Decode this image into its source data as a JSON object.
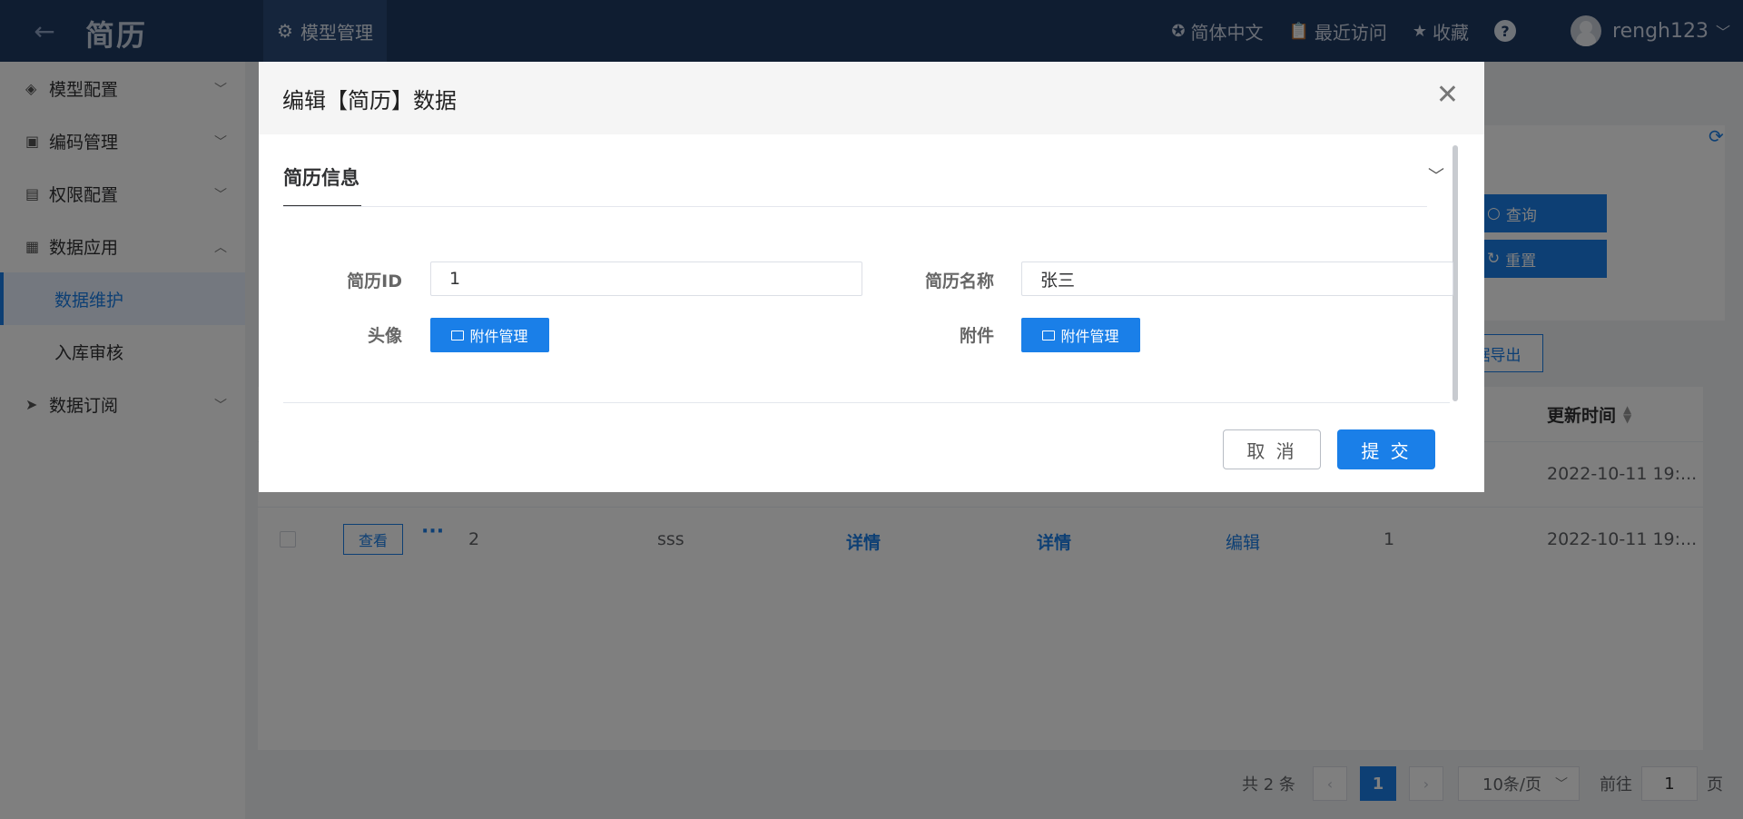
{
  "header": {
    "title": "简历",
    "tab_label": "模型管理",
    "language": "简体中文",
    "recent": "最近访问",
    "favorites": "收藏",
    "help": "?",
    "username": "rengh123"
  },
  "sidebar": {
    "items": [
      {
        "label": "模型配置",
        "icon": "cube-icon"
      },
      {
        "label": "编码管理",
        "icon": "chart-icon"
      },
      {
        "label": "权限配置",
        "icon": "lock-doc-icon"
      },
      {
        "label": "数据应用",
        "icon": "grid-icon"
      }
    ],
    "sub_items": [
      "数据维护",
      "入库审核"
    ],
    "last_item": {
      "label": "数据订阅",
      "icon": "send-icon"
    }
  },
  "background": {
    "query_btn": "查询",
    "reset_btn": "重置",
    "export_btn": "据导出",
    "col_update_time": "更新时间",
    "row1": {
      "time": "2022-10-11 19:..."
    },
    "row2": {
      "view": "查看",
      "dots": "···",
      "id": "2",
      "name": "sss",
      "detail1": "详情",
      "detail2": "详情",
      "edit": "编辑",
      "count": "1",
      "time": "2022-10-11 19:..."
    },
    "pager": {
      "total": "共 2 条",
      "current": "1",
      "page_size": "10条/页",
      "goto": "前往",
      "goto_value": "1",
      "page_suffix": "页"
    }
  },
  "modal": {
    "title": "编辑【简历】数据",
    "section": "简历信息",
    "fields": {
      "id_label": "简历ID",
      "id_value": "1",
      "name_label": "简历名称",
      "name_value": "张三",
      "avatar_label": "头像",
      "attachment_label": "附件",
      "attach_btn": "附件管理"
    },
    "cancel": "取 消",
    "submit": "提 交"
  },
  "colors": {
    "header_bg": "#1f3a63",
    "primary": "#1a7fe8"
  }
}
